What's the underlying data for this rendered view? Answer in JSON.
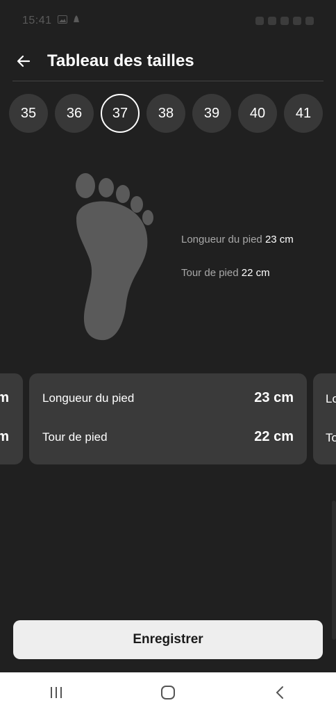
{
  "status_bar": {
    "time": "15:41"
  },
  "header": {
    "title": "Tableau des tailles"
  },
  "sizes": {
    "options": [
      "35",
      "36",
      "37",
      "38",
      "39",
      "40",
      "41"
    ],
    "selected": "37"
  },
  "foot_info": {
    "length_label": "Longueur du pied",
    "length_value": "23 cm",
    "girth_label": "Tour de pied",
    "girth_value": "22 cm"
  },
  "cards": {
    "left_partial": {
      "row1": "m",
      "row2": "m"
    },
    "center": {
      "length_label": "Longueur du pied",
      "length_value": "23 cm",
      "girth_label": "Tour de pied",
      "girth_value": "22 cm"
    },
    "right_partial": {
      "row1": "Lo",
      "row2": "To"
    }
  },
  "actions": {
    "save_label": "Enregistrer"
  },
  "navigation": {
    "recents_icon": "recents-icon",
    "home_icon": "home-icon",
    "back_icon": "back-chevron-icon"
  },
  "colors": {
    "background": "#202020",
    "chip": "#383838",
    "card": "#3a3a3a",
    "button": "#eeeeee",
    "foot": "#5a5a5a"
  }
}
